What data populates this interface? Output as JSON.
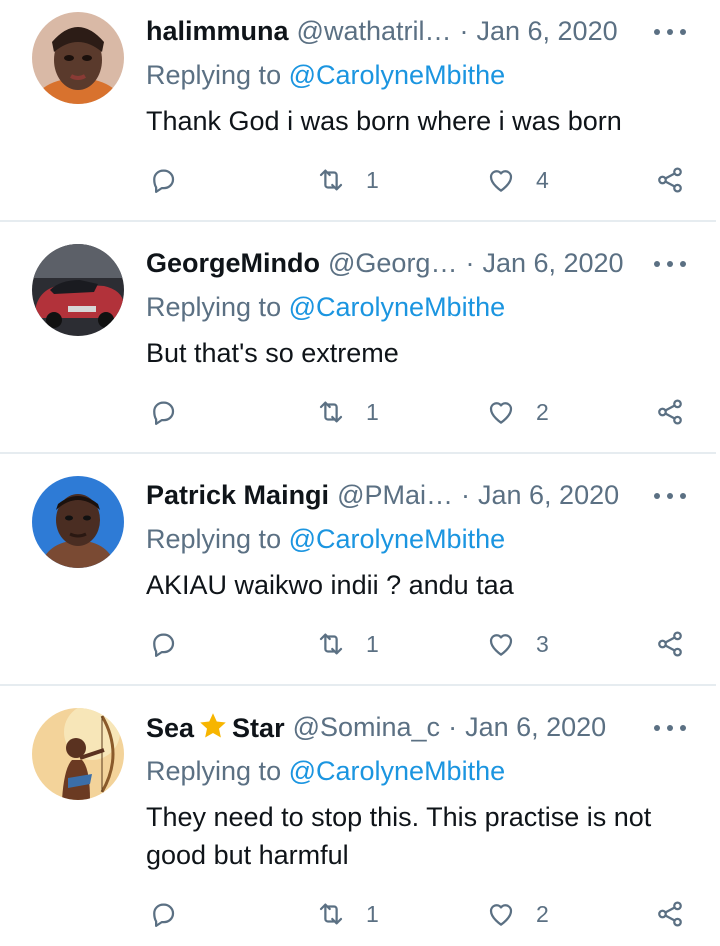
{
  "common": {
    "replying_prefix": "Replying to",
    "replying_to": "@CarolyneMbithe",
    "separator": "·"
  },
  "tweets": [
    {
      "name": "halimmuna",
      "handle": "@wathatril…",
      "date": "Jan 6, 2020",
      "text": "Thank God i was born where i was born",
      "retweets": "1",
      "likes": "4",
      "avatar": "woman-face",
      "avatar_color": "#6a4c3f"
    },
    {
      "name": "GeorgeMindo",
      "handle": "@Georg…",
      "date": "Jan 6, 2020",
      "text": "But that's so extreme",
      "retweets": "1",
      "likes": "2",
      "avatar": "red-car",
      "avatar_color": "#b2323a"
    },
    {
      "name": "Patrick Maingi",
      "handle": "@PMai…",
      "date": "Jan 6, 2020",
      "text": "AKIAU waikwo indii ? andu taa",
      "retweets": "1",
      "likes": "3",
      "avatar": "man-blue-background",
      "avatar_color": "#2e7bd6"
    },
    {
      "name_prefix": "Sea",
      "name_suffix": "Star",
      "name_icon": "star-emoji",
      "handle": "@Somina_c",
      "date": "Jan 6, 2020",
      "text": "They need to stop this. This practise is not good but harmful",
      "retweets": "1",
      "likes": "2",
      "avatar": "archer-illustration",
      "avatar_color": "#f3d39a"
    }
  ],
  "colors": {
    "text": "#0f1419",
    "secondary": "#5b7083",
    "link": "#1b95e0",
    "divider": "#e6ecf0",
    "star": "#f7b500"
  }
}
